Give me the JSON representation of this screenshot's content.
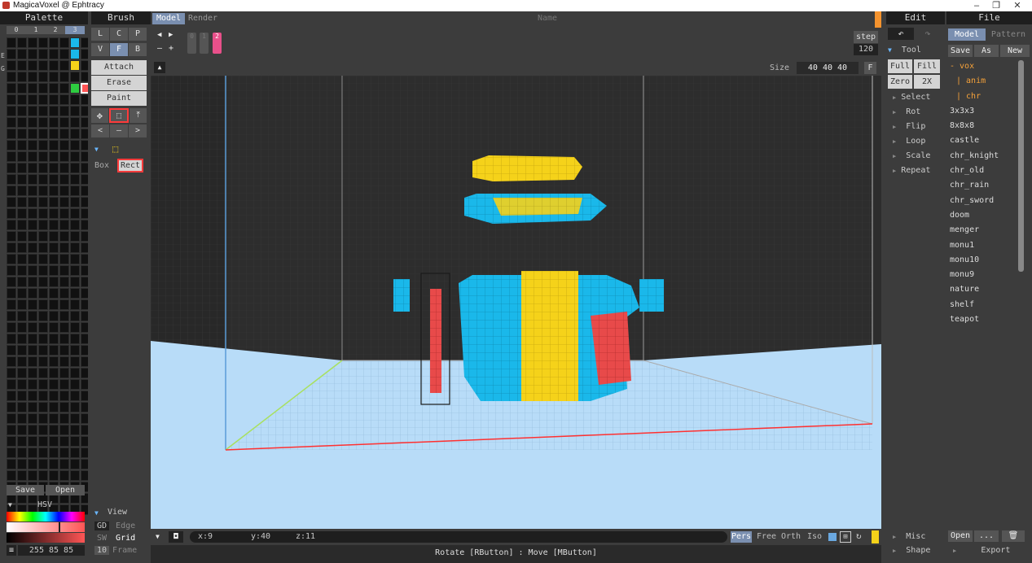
{
  "window": {
    "title": "MagicaVoxel @ Ephtracy",
    "min": "–",
    "max": "❐",
    "close": "✕"
  },
  "palette": {
    "title": "Palette",
    "tabs": [
      "0",
      "1",
      "2",
      "3"
    ],
    "side_e": "E",
    "side_g": "G",
    "save": "Save",
    "open": "Open",
    "mode": "HSV",
    "value": "255 85 85",
    "menu": "≡"
  },
  "brush": {
    "title": "Brush",
    "modes_row1": [
      "L",
      "C",
      "P"
    ],
    "modes_row2": [
      "V",
      "F",
      "B"
    ],
    "actions": [
      "Attach",
      "Erase",
      "Paint"
    ],
    "nav": [
      "<",
      "–",
      ">"
    ],
    "shapes": [
      "Box",
      "Rect"
    ]
  },
  "view": {
    "title": "View",
    "rows": [
      [
        "GD",
        "Edge"
      ],
      [
        "SW",
        "Grid"
      ],
      [
        "10",
        "Frame"
      ]
    ]
  },
  "top": {
    "tabs": [
      "Model",
      "Render"
    ],
    "name": "Name",
    "frames": [
      "0",
      "1",
      "2"
    ],
    "step_label": "step",
    "step_value": "120",
    "size_label": "Size",
    "size_value": "40 40 40",
    "f": "F"
  },
  "viewport": {
    "coords": {
      "x": "x:9",
      "y": "y:40",
      "z": "z:11"
    },
    "projections": [
      "Pers",
      "Free",
      "Orth",
      "Iso"
    ],
    "hint": "Rotate [RButton] : Move [MButton]"
  },
  "edit": {
    "title": "Edit",
    "tool": "Tool",
    "buttons": [
      "Full",
      "Fill",
      "Zero",
      "2X"
    ],
    "tools": [
      "Select",
      "Rot",
      "Flip",
      "Loop",
      "Scale",
      "Repeat"
    ],
    "misc": "Misc",
    "shape": "Shape"
  },
  "file": {
    "title": "File",
    "tabs": [
      "Model",
      "Pattern"
    ],
    "actions": [
      "Save",
      "As",
      "New"
    ],
    "tree": [
      "- vox",
      "| anim",
      "| chr"
    ],
    "items": [
      "3x3x3",
      "8x8x8",
      "castle",
      "chr_knight",
      "chr_old",
      "chr_rain",
      "chr_sword",
      "doom",
      "menger",
      "monu1",
      "monu10",
      "monu9",
      "nature",
      "shelf",
      "teapot"
    ],
    "open": "Open",
    "dots": "...",
    "export": "Export"
  },
  "colors": {
    "accent": "#7a8fb0",
    "selected": "#ff5555",
    "voxel_blue": "#1ab8ea",
    "voxel_yellow": "#f5d21a",
    "voxel_red": "#e84a4a",
    "floor": "#b8dcf8"
  }
}
